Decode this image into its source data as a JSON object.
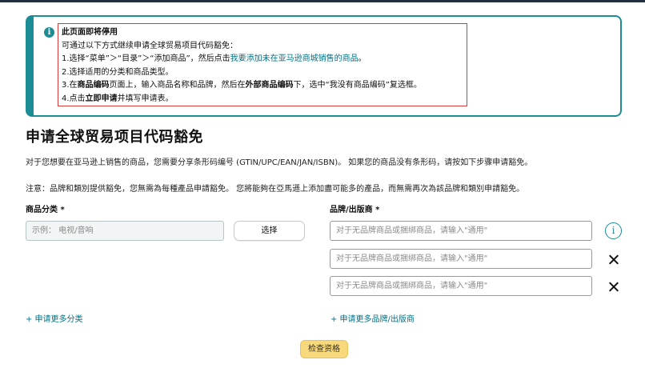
{
  "alert": {
    "icon": "info-icon",
    "title": "此页面即将停用",
    "intro": "可通过以下方式继续申请全球贸易项目代码豁免：",
    "step1_pre": "1.选择“菜单”＞“目录”＞“添加商品”，然后点击",
    "step1_link": "我要添加未在亚马逊商城销售的商品",
    "step1_post": "。",
    "step2": "2.选择适用的分类和商品类型。",
    "step3_a": "3.在",
    "step3_b": "商品编码",
    "step3_c": "页面上，输入商品名称和品牌，然后在",
    "step3_d": "外部商品编码",
    "step3_e": "下，选中“我没有商品编码”复选框。",
    "step4_a": "4.点击",
    "step4_b": "立即申请",
    "step4_c": "并填写申请表。"
  },
  "page_title": "申请全球贸易项目代码豁免",
  "description": "对于您想要在亚马逊上销售的商品，您需要分享条形码编号 (GTIN/UPC/EAN/JAN/ISBN)。 如果您的商品没有条形码，请按如下步骤申请豁免。",
  "note": "注意：品牌和類別提供豁免，您無需為每種產品申請豁免。 您將能夠在亞馬遜上添加盡可能多的產品，而無需再次為該品牌和類別申請豁免。",
  "category": {
    "label": "商品分类 *",
    "placeholder": "示例： 电视/音响",
    "select_button": "选择",
    "add_more": "+ 申请更多分类"
  },
  "brand": {
    "label": "品牌/出版商 *",
    "placeholder": "对于无品牌商品或捆绑商品，请输入\"通用\"",
    "add_more": "+ 申请更多品牌/出版商"
  },
  "check_button": "检查资格",
  "colors": {
    "accent": "#1c8c95",
    "link": "#007185",
    "highlight_border": "#d23c3c",
    "primary_button": "#f7d87a"
  }
}
